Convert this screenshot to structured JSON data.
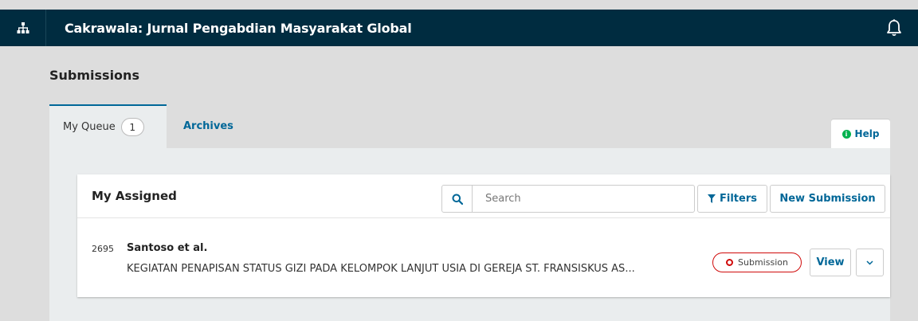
{
  "app": {
    "journal_title": "Cakrawala: Jurnal Pengabdian Masyarakat Global"
  },
  "page": {
    "title": "Submissions"
  },
  "tabs": [
    {
      "label": "My Queue",
      "count": "1",
      "active": true
    },
    {
      "label": "Archives",
      "active": false
    }
  ],
  "help": {
    "label": "Help",
    "icon": "info-icon"
  },
  "panel": {
    "title": "My Assigned",
    "search_placeholder": "Search",
    "filters_label": "Filters",
    "new_submission_label": "New Submission"
  },
  "submissions": [
    {
      "id": "2695",
      "author": "Santoso et al.",
      "title": "KEGIATAN PENAPISAN STATUS GIZI PADA KELOMPOK LANJUT USIA DI GEREJA ST. FRANSISKUS AS...",
      "status": "Submission",
      "view_label": "View"
    }
  ],
  "colors": {
    "topbar": "#002c40",
    "link": "#006798",
    "status_red": "#d00a0a",
    "help_green": "#00b24e"
  }
}
